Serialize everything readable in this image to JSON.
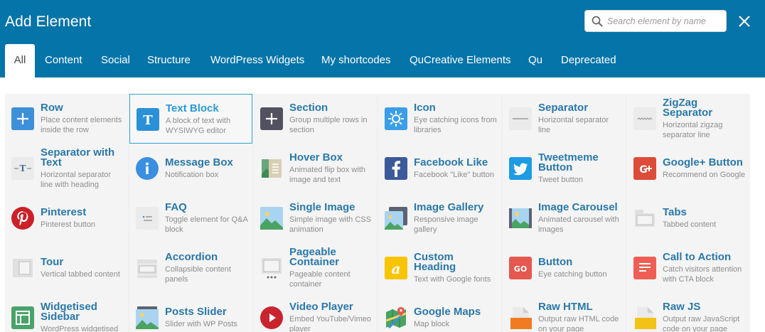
{
  "header": {
    "title": "Add Element",
    "search_placeholder": "Search element by name",
    "close_label": "✕"
  },
  "tabs": [
    {
      "label": "All",
      "active": true
    },
    {
      "label": "Content"
    },
    {
      "label": "Social"
    },
    {
      "label": "Structure"
    },
    {
      "label": "WordPress Widgets"
    },
    {
      "label": "My shortcodes"
    },
    {
      "label": "QuCreative Elements"
    },
    {
      "label": "Qu"
    },
    {
      "label": "Deprecated"
    }
  ],
  "elements": [
    [
      {
        "name": "Row",
        "desc": "Place content elements inside the row",
        "icon": "plus-blue-icon"
      },
      {
        "name": "Text Block",
        "desc": "A block of text with WYSIWYG editor",
        "icon": "text-block-icon",
        "selected": true
      },
      {
        "name": "Section",
        "desc": "Group multiple rows in section",
        "icon": "plus-dark-icon"
      },
      {
        "name": "Icon",
        "desc": "Eye catching icons from libraries",
        "icon": "sun-icon"
      },
      {
        "name": "Separator",
        "desc": "Horizontal separator line",
        "icon": "separator-icon"
      },
      {
        "name": "ZigZag Separator",
        "desc": "Horizontal zigzag separator line",
        "icon": "zigzag-icon"
      }
    ],
    [
      {
        "name": "Separator with Text",
        "desc": "Horizontal separator line with heading",
        "icon": "separator-text-icon"
      },
      {
        "name": "Message Box",
        "desc": "Notification box",
        "icon": "info-icon"
      },
      {
        "name": "Hover Box",
        "desc": "Animated flip box with image and text",
        "icon": "hover-box-icon"
      },
      {
        "name": "Facebook Like",
        "desc": "Facebook \"Like\" button",
        "icon": "facebook-icon"
      },
      {
        "name": "Tweetmeme Button",
        "desc": "Tweet button",
        "icon": "twitter-icon"
      },
      {
        "name": "Google+ Button",
        "desc": "Recommend on Google",
        "icon": "google-plus-icon"
      }
    ],
    [
      {
        "name": "Pinterest",
        "desc": "Pinterest button",
        "icon": "pinterest-icon"
      },
      {
        "name": "FAQ",
        "desc": "Toggle element for Q&A block",
        "icon": "faq-icon"
      },
      {
        "name": "Single Image",
        "desc": "Simple image with CSS animation",
        "icon": "image-icon"
      },
      {
        "name": "Image Gallery",
        "desc": "Responsive image gallery",
        "icon": "gallery-icon"
      },
      {
        "name": "Image Carousel",
        "desc": "Animated carousel with images",
        "icon": "carousel-icon"
      },
      {
        "name": "Tabs",
        "desc": "Tabbed content",
        "icon": "tabs-icon"
      }
    ],
    [
      {
        "name": "Tour",
        "desc": "Vertical tabbed content",
        "icon": "tour-icon"
      },
      {
        "name": "Accordion",
        "desc": "Collapsible content panels",
        "icon": "accordion-icon"
      },
      {
        "name": "Pageable Container",
        "desc": "Pageable content container",
        "icon": "pageable-icon"
      },
      {
        "name": "Custom Heading",
        "desc": "Text with Google fonts",
        "icon": "custom-heading-icon"
      },
      {
        "name": "Button",
        "desc": "Eye catching button",
        "icon": "go-button-icon"
      },
      {
        "name": "Call to Action",
        "desc": "Catch visitors attention with CTA block",
        "icon": "cta-icon"
      }
    ],
    [
      {
        "name": "Widgetised Sidebar",
        "desc": "WordPress widgetised",
        "icon": "sidebar-icon"
      },
      {
        "name": "Posts Slider",
        "desc": "Slider with WP Posts",
        "icon": "posts-slider-icon"
      },
      {
        "name": "Video Player",
        "desc": "Embed YouTube/Vimeo player",
        "icon": "video-play-icon"
      },
      {
        "name": "Google Maps",
        "desc": "Map block",
        "icon": "map-icon"
      },
      {
        "name": "Raw HTML",
        "desc": "Output raw HTML code on your page",
        "icon": "raw-html-icon"
      },
      {
        "name": "Raw JS",
        "desc": "Output raw JavaScript code on your page",
        "icon": "raw-js-icon"
      }
    ]
  ]
}
